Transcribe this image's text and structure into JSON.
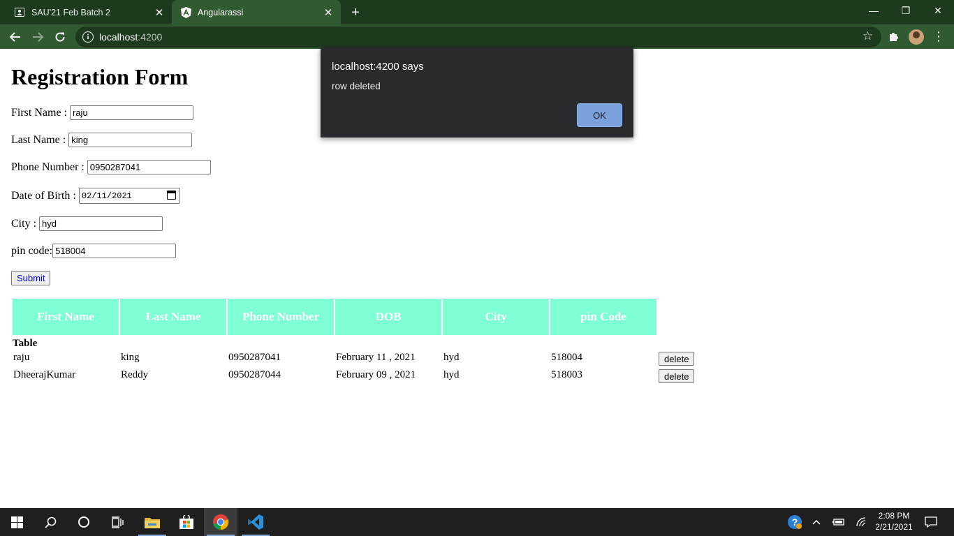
{
  "browser": {
    "tabs": [
      {
        "title": "SAU'21 Feb Batch 2",
        "active": false
      },
      {
        "title": "Angularassi",
        "active": true
      }
    ],
    "url_host": "localhost",
    "url_port": ":4200"
  },
  "form": {
    "heading": "Registration Form",
    "fields": {
      "first_name": {
        "label": "First Name :",
        "value": "raju"
      },
      "last_name": {
        "label": "Last Name :",
        "value": "king"
      },
      "phone": {
        "label": "Phone Number :",
        "value": "0950287041"
      },
      "dob": {
        "label": "Date of Birth :",
        "value": "02/11/2021"
      },
      "city": {
        "label": "City :",
        "value": "hyd"
      },
      "pin": {
        "label": "pin code:",
        "value": "518004"
      }
    },
    "submit_label": "Submit"
  },
  "table": {
    "columns": [
      "First Name",
      "Last Name",
      "Phone Number",
      "DOB",
      "City",
      "pin Code"
    ],
    "caption": "Table",
    "rows": [
      {
        "first": "raju",
        "last": "king",
        "phone": "0950287041",
        "dob": "February 11 , 2021",
        "city": "hyd",
        "pin": "518004",
        "action": "delete"
      },
      {
        "first": "DheerajKumar",
        "last": "Reddy",
        "phone": "0950287044",
        "dob": "February 09 , 2021",
        "city": "hyd",
        "pin": "518003",
        "action": "delete"
      }
    ]
  },
  "alert": {
    "title": "localhost:4200 says",
    "message": "row deleted",
    "ok_label": "OK"
  },
  "taskbar": {
    "time": "2:08 PM",
    "date": "2/21/2021"
  },
  "colors": {
    "chrome_dark": "#1e3a1e",
    "chrome_toolbar": "#325a32",
    "table_header": "#7fffd4",
    "dialog_bg": "#292a2d",
    "dialog_ok": "#7ba1dc"
  }
}
